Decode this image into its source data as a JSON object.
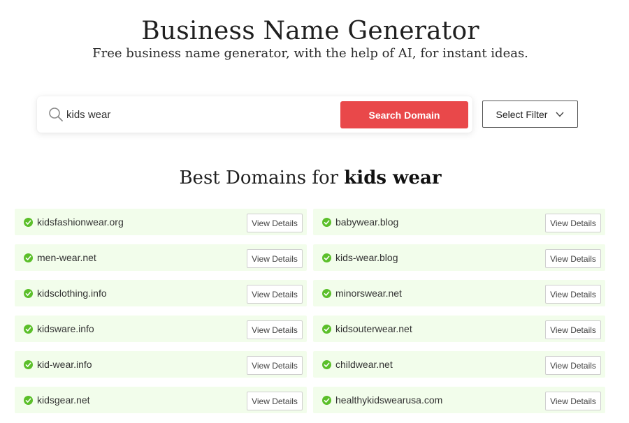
{
  "header": {
    "title": "Business Name Generator",
    "subtitle": "Free business name generator, with the help of AI, for instant ideas."
  },
  "search": {
    "value": "kids wear",
    "button_label": "Search Domain",
    "filter_label": "Select Filter"
  },
  "results": {
    "heading_prefix": "Best Domains for",
    "keyword": "kids wear",
    "action_label": "View Details",
    "domains": [
      "kidsfashionwear.org",
      "babywear.blog",
      "men-wear.net",
      "kids-wear.blog",
      "kidsclothing.info",
      "minorswear.net",
      "kidsware.info",
      "kidsouterwear.net",
      "kid-wear.info",
      "childwear.net",
      "kidsgear.net",
      "healthykidswearusa.com"
    ]
  },
  "colors": {
    "accent": "#e9484a",
    "row_bg": "#f2fdeb",
    "check": "#5bbf2a"
  }
}
